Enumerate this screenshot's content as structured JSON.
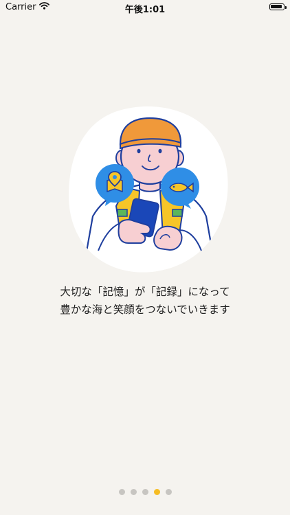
{
  "status_bar": {
    "carrier": "Carrier",
    "time": "午後1:01"
  },
  "onboarding": {
    "line1": "大切な「記憶」が「記録」になって",
    "line2": "豊かな海と笑顔をつないでいきます"
  },
  "pager": {
    "total_pages": 5,
    "current_page": 4
  },
  "colors": {
    "background": "#f5f3ef",
    "accent_dot": "#f6bc23",
    "inactive_dot": "#c7c5c1",
    "outline_blue": "#1f3f9e",
    "bubble_blue": "#2f8ee6",
    "cap_orange": "#f0993a",
    "skin": "#f7cfd2",
    "vest_yellow": "#f6c528",
    "phone_blue": "#1a47b8",
    "strap_green": "#5cb65a"
  }
}
